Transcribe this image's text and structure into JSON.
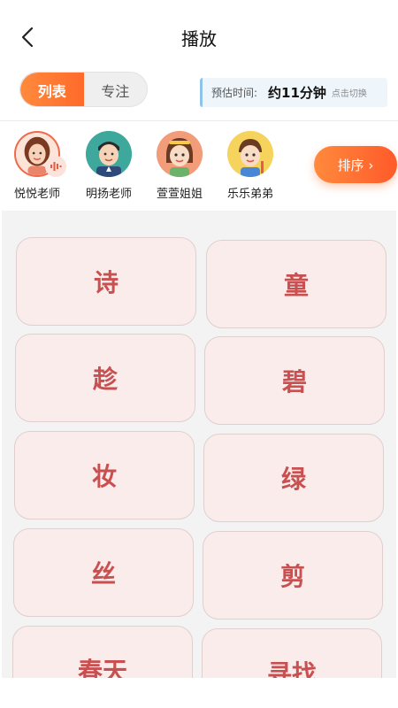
{
  "header": {
    "title": "播放",
    "back_icon": "chevron-left-icon"
  },
  "mode": {
    "tabs": [
      {
        "label": "列表",
        "active": true
      },
      {
        "label": "专注",
        "active": false
      }
    ]
  },
  "estimate": {
    "label": "预估时间:",
    "value": "约11分钟",
    "switch_label": "点击切换"
  },
  "voices": [
    {
      "name": "悦悦老师",
      "selected": true
    },
    {
      "name": "明扬老师",
      "selected": false
    },
    {
      "name": "萱萱姐姐",
      "selected": false
    },
    {
      "name": "乐乐弟弟",
      "selected": false
    }
  ],
  "sort_button": {
    "label": "排序 ›"
  },
  "words": [
    {
      "text": "诗"
    },
    {
      "text": "童"
    },
    {
      "text": "趁"
    },
    {
      "text": "碧"
    },
    {
      "text": "妆"
    },
    {
      "text": "绿"
    },
    {
      "text": "丝"
    },
    {
      "text": "剪"
    },
    {
      "text": "春天"
    },
    {
      "text": "寻找"
    }
  ],
  "colors": {
    "accent": "#ff6a2a",
    "word_text": "#c95050",
    "card_bg": "#fbecec"
  }
}
